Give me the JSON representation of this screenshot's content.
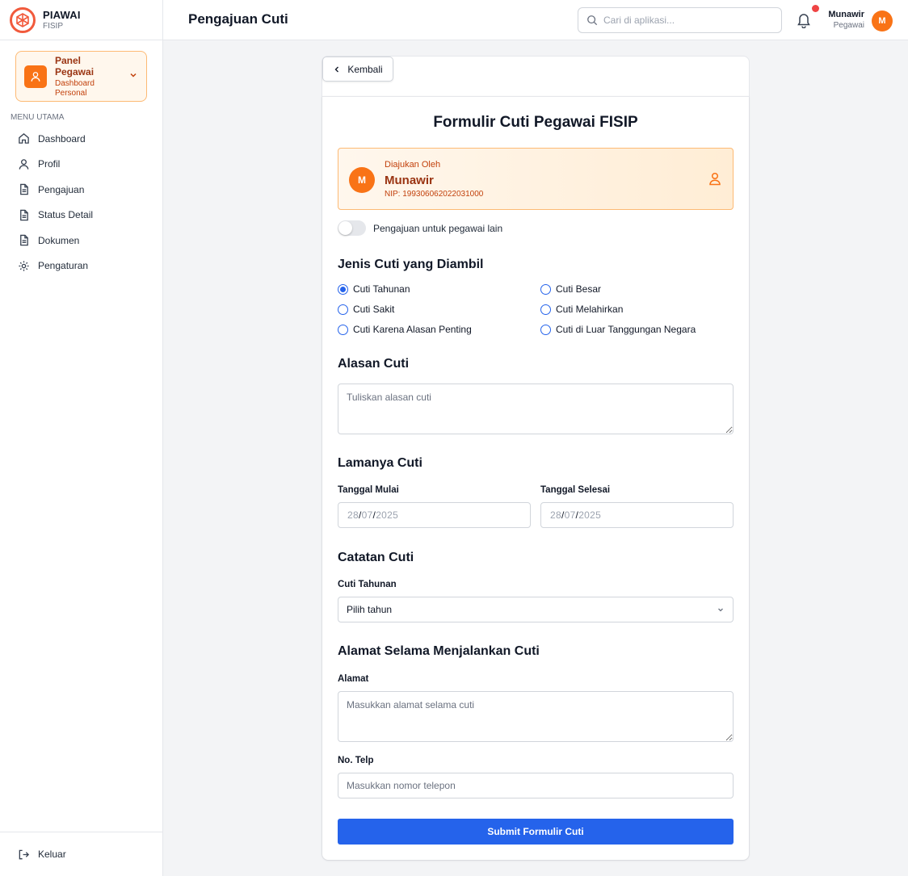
{
  "brand": {
    "name": "PIAWAI",
    "sub": "FISIP"
  },
  "panel": {
    "title": "Panel Pegawai",
    "subtitle": "Dashboard Personal"
  },
  "menu": {
    "title": "MENU UTAMA",
    "items": [
      "Dashboard",
      "Profil",
      "Pengajuan",
      "Status Detail",
      "Dokumen",
      "Pengaturan"
    ]
  },
  "logout_label": "Keluar",
  "header": {
    "title": "Pengajuan Cuti",
    "search_placeholder": "Cari di aplikasi...",
    "user_name": "Munawir",
    "user_role": "Pegawai",
    "user_initial": "M"
  },
  "back_label": "Kembali",
  "form": {
    "title": "Formulir Cuti Pegawai FISIP",
    "submitter": {
      "label": "Diajukan Oleh",
      "name": "Munawir",
      "nip": "NIP: 199306062022031000",
      "initial": "M"
    },
    "toggle_label": "Pengajuan untuk pegawai lain",
    "leave_type": {
      "heading": "Jenis Cuti yang Diambil",
      "options": [
        "Cuti Tahunan",
        "Cuti Besar",
        "Cuti Sakit",
        "Cuti Melahirkan",
        "Cuti Karena Alasan Penting",
        "Cuti di Luar Tanggungan Negara"
      ],
      "selected": "Cuti Tahunan"
    },
    "reason": {
      "heading": "Alasan Cuti",
      "placeholder": "Tuliskan alasan cuti"
    },
    "duration": {
      "heading": "Lamanya Cuti",
      "start_label": "Tanggal Mulai",
      "end_label": "Tanggal Selesai",
      "start": {
        "dd": "28",
        "mm": "07",
        "yyyy": "2025"
      },
      "end": {
        "dd": "28",
        "mm": "07",
        "yyyy": "2025"
      }
    },
    "notes": {
      "heading": "Catatan Cuti",
      "label": "Cuti Tahunan",
      "select_value": "Pilih tahun"
    },
    "address": {
      "heading": "Alamat Selama Menjalankan Cuti",
      "address_label": "Alamat",
      "address_placeholder": "Masukkan alamat selama cuti",
      "phone_label": "No. Telp",
      "phone_placeholder": "Masukkan nomor telepon"
    },
    "submit_label": "Submit Formulir Cuti"
  },
  "colors": {
    "accent": "#f97316",
    "primary": "#2563eb",
    "notification": "#ef4444"
  }
}
